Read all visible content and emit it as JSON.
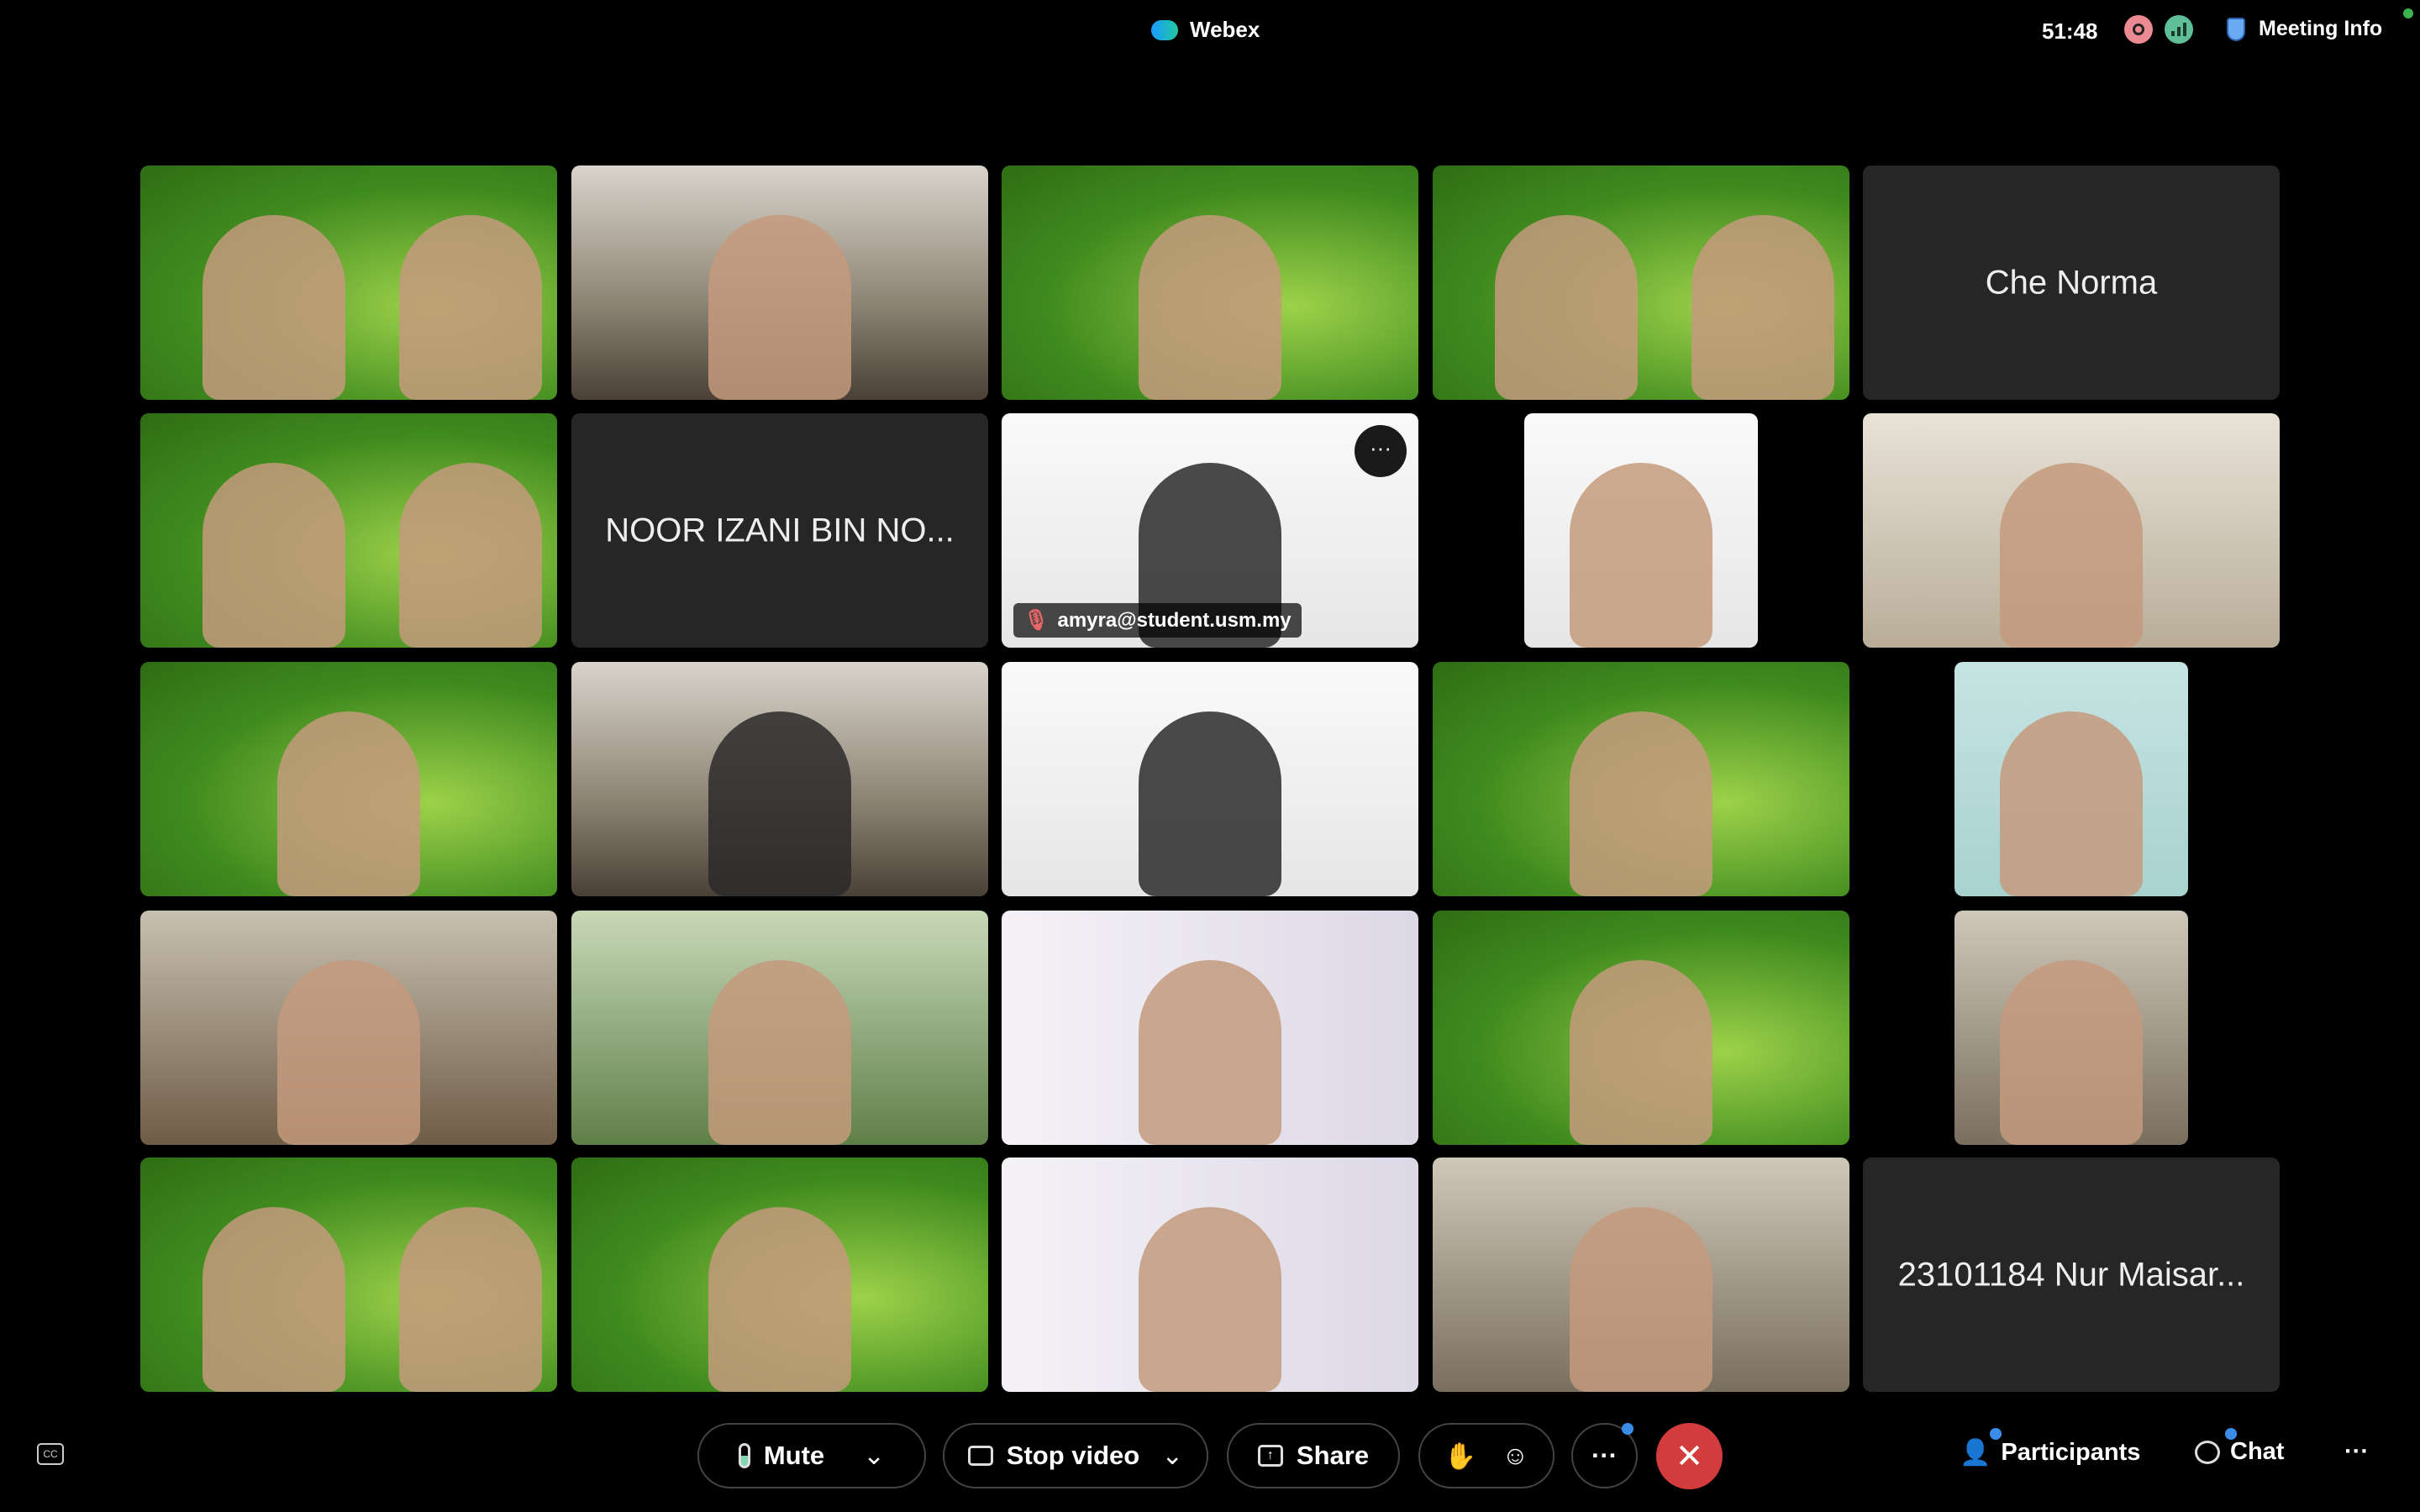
{
  "header": {
    "app": "Webex",
    "timer": "51:48",
    "meeting_info": "Meeting Info"
  },
  "tiles": [
    {
      "scene": "green",
      "people": 2
    },
    {
      "scene": "office",
      "people": 1
    },
    {
      "scene": "green",
      "people": 1
    },
    {
      "scene": "green",
      "people": 2
    },
    {
      "name": "Che Norma"
    },
    {
      "scene": "green",
      "people": 2
    },
    {
      "name": "NOOR IZANI BIN NO..."
    },
    {
      "scene": "white",
      "people": 1,
      "dark": true,
      "label": "amyra@student.usm.my",
      "muted": true,
      "more": "···"
    },
    {
      "scene": "white",
      "people": 1,
      "narrow": true
    },
    {
      "scene": "light",
      "people": 1
    },
    {
      "scene": "green",
      "people": 1
    },
    {
      "scene": "office",
      "people": 1,
      "dark": true
    },
    {
      "scene": "white",
      "people": 1,
      "dark": true
    },
    {
      "scene": "green",
      "people": 1
    },
    {
      "scene": "teal",
      "people": 1,
      "narrow": true
    },
    {
      "scene": "lab",
      "people": 1
    },
    {
      "scene": "park",
      "people": 1
    },
    {
      "scene": "usm",
      "people": 1
    },
    {
      "scene": "green",
      "people": 1
    },
    {
      "scene": "room",
      "people": 1,
      "narrow": true
    },
    {
      "scene": "green",
      "people": 2
    },
    {
      "scene": "green",
      "people": 1
    },
    {
      "scene": "usm",
      "people": 1
    },
    {
      "scene": "room",
      "people": 1
    },
    {
      "name": "23101184 Nur Maisar..."
    }
  ],
  "controls": {
    "mute": "Mute",
    "stop_video": "Stop video",
    "share": "Share",
    "more": "···",
    "leave": "✕",
    "participants": "Participants",
    "chat": "Chat",
    "overflow": "···",
    "cc": "CC"
  },
  "colors": {
    "leave": "#d33c3c",
    "recording": "#ec8a94",
    "signal": "#5fbf98",
    "badge": "#3a8ce8"
  }
}
